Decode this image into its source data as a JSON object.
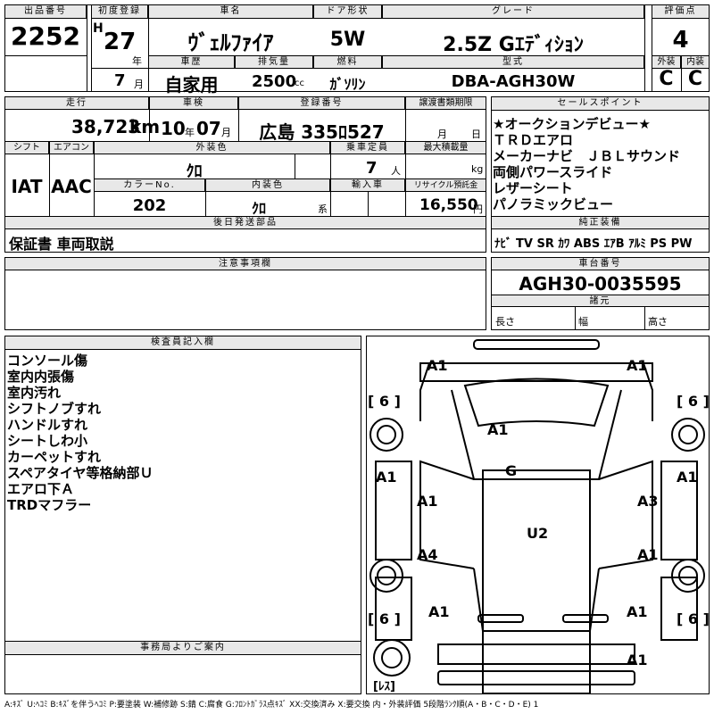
{
  "top": {
    "lot_label": "出品番号",
    "lot": "2252",
    "first_reg_label": "初度登録",
    "era": "H",
    "year": "27",
    "year_unit": "年",
    "month": "7",
    "month_unit": "月",
    "name_label": "車名",
    "name": "ｳﾞｪﾙﾌｧｲｱ",
    "door_label": "ドア形状",
    "door": "5W",
    "grade_label": "グレード",
    "grade": "2.5Z Gｴﾃﾞｨｼｮﾝ",
    "score_label": "評価点",
    "score": "4",
    "history_label": "車歴",
    "history": "自家用",
    "disp_label": "排気量",
    "disp": "2500",
    "disp_unit": "cc",
    "fuel_label": "燃料",
    "fuel": "ｶﾞｿﾘﾝ",
    "model_label": "型式",
    "model": "DBA-AGH30W",
    "ext_label": "外装",
    "ext": "C",
    "int_label": "内装",
    "int": "C"
  },
  "mid": {
    "mileage_label": "走行",
    "mileage": "38,723",
    "mileage_unit": "km",
    "inspect_label": "車検",
    "inspect_y": "10",
    "inspect_y_unit": "年",
    "inspect_m": "07",
    "inspect_m_unit": "月",
    "plate_label": "登録番号",
    "plate": "広島 335ﾛ527",
    "transfer_label": "譲渡書類期限",
    "transfer_m_unit": "月",
    "transfer_d_unit": "日",
    "shift_label": "シフト",
    "ac_label": "エアコン",
    "shift": "IAT",
    "ac": "AAC",
    "color_label": "外装色",
    "color": "ｸﾛ",
    "capacity_label": "乗車定員",
    "capacity": "7",
    "capacity_unit": "人",
    "load_label": "最大積載量",
    "load_unit": "kg",
    "colorno_label": "カラーNo.",
    "colorno": "202",
    "intcolor_label": "内装色",
    "intcolor": "ｸﾛ",
    "intcolor_unit": "系",
    "import_label": "輸入車",
    "recycle_label": "リサイクル預託金",
    "recycle": "16,550",
    "recycle_unit": "円",
    "later_label": "後日発送部品",
    "later": "保証書 車両取説",
    "notes_label": "注意事項欄",
    "office_label": "事務局よりご案内"
  },
  "sales": {
    "label": "セールスポイント",
    "items": [
      "★オークションデビュー★",
      "ＴＲＤエアロ",
      "メーカーナビ　ＪＢＬサウンド",
      "両側パワースライド",
      "レザーシート",
      "パノラミックビュー"
    ]
  },
  "equip": {
    "label": "純正装備",
    "text": "ﾅﾋﾞ TV SR ｶﾜ ABS ｴｱB ｱﾙﾐ PS PW"
  },
  "chassis": {
    "label": "車台番号",
    "value": "AGH30-0035595",
    "spec_label": "諸元",
    "len": "長さ",
    "wid": "幅",
    "hei": "高さ"
  },
  "inspector": {
    "label": "検査員記入欄",
    "items": [
      "コンソール傷",
      "室内内張傷",
      "室内汚れ",
      "シフトノブすれ",
      "ハンドルすれ",
      "シートしわ小",
      "カーペットすれ",
      "スペアタイヤ等格納部Ｕ",
      "エアロ下Ａ",
      "TRDマフラー"
    ]
  },
  "diagram": {
    "marks": [
      "A1",
      "A1",
      "[ 6 ]",
      "[ 6 ]",
      "A1",
      "A1",
      "A1",
      "G",
      "A1",
      "A3",
      "A4",
      "U2",
      "A1",
      "A1",
      "[ 6 ]",
      "[ 6 ]",
      "A1",
      "A1",
      "[ﾚｽ]"
    ]
  },
  "legend": "A:ｷｽﾞ U:ﾍｺﾐ B:ｷｽﾞを伴うﾍｺﾐ P:要塗装 W:補修跡 S:錆 C:腐食 G:ﾌﾛﾝﾄｶﾞﾗｽ点ｷｽﾞ XX:交換済み X:要交換 内・外装評価 5段階ﾗﾝｸ順(A・B・C・D・E) 1"
}
